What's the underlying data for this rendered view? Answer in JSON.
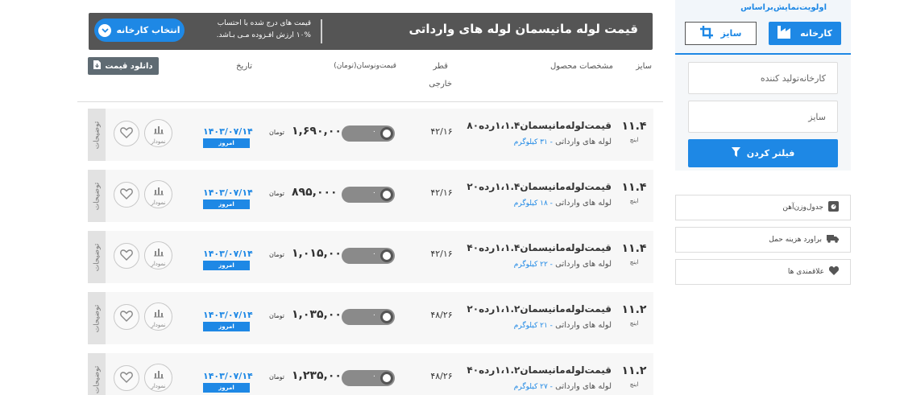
{
  "header": {
    "title": "قیمت لوله مانیسمان لوله های وارداتی",
    "note_line1": "قیمت های درج شده با احتساب",
    "note_line2": "۱۰% ارزش افـزوده مـی بـاشد.",
    "select_factory_label": "انتخاب کارخانه"
  },
  "toolbar": {
    "download_label": "دانلود قیمت"
  },
  "columns": {
    "size": "سایز",
    "specs": "مشخصات محصول",
    "dia_line1": "قطر",
    "dia_line2": "خارجی",
    "price": "قیمت‌ونوسان(تومان)",
    "date": "تاریخ"
  },
  "row_labels": {
    "notes": "توضیحات",
    "chart": "نمودار",
    "today": "امروز",
    "currency": "تومان",
    "size_unit": "اینچ",
    "fluct_value": "۰"
  },
  "rows": [
    {
      "size": "۱۱.۴",
      "title": "قیمت‌لوله‌مانیسمان۱،۱.۴رده۸۰",
      "sub": "لوله های وارداتی",
      "weight": "- ۳۱ کیلوگرم",
      "dia": "۴۲/۱۶",
      "price": "۱,۶۹۰,۰۰۰",
      "date": "۱۴۰۳/۰۷/۱۴"
    },
    {
      "size": "۱۱.۴",
      "title": "قیمت‌لوله‌مانیسمان۱،۱.۴رده۲۰",
      "sub": "لوله های وارداتی",
      "weight": "- ۱۸ کیلوگرم",
      "dia": "۴۲/۱۶",
      "price": "۸۹۵,۰۰۰",
      "date": "۱۴۰۳/۰۷/۱۴"
    },
    {
      "size": "۱۱.۴",
      "title": "قیمت‌لوله‌مانیسمان۱،۱.۴رده۴۰",
      "sub": "لوله های وارداتی",
      "weight": "- ۲۲ کیلوگرم",
      "dia": "۴۲/۱۶",
      "price": "۱,۰۱۵,۰۰۰",
      "date": "۱۴۰۳/۰۷/۱۴"
    },
    {
      "size": "۱۱.۲",
      "title": "قیمت‌لوله‌مانیسمان۱،۱.۲رده۲۰",
      "sub": "لوله های وارداتی",
      "weight": "- ۲۱ کیلوگرم",
      "dia": "۴۸/۲۶",
      "price": "۱,۰۳۵,۰۰۰",
      "date": "۱۴۰۳/۰۷/۱۴"
    },
    {
      "size": "۱۱.۲",
      "title": "قیمت‌لوله‌مانیسمان۱،۱.۲رده۴۰",
      "sub": "لوله های وارداتی",
      "weight": "- ۲۷ کیلوگرم",
      "dia": "۴۸/۲۶",
      "price": "۱,۲۳۵,۰۰۰",
      "date": "۱۴۰۳/۰۷/۱۴"
    }
  ],
  "sidebar": {
    "priority_title": "اولویت‌نمایش‌براساس",
    "tab_factory": "کارخانه",
    "tab_size": "سایز",
    "manufacturer_placeholder": "کارخانه‌تولید کننده",
    "size_placeholder": "سایز",
    "filter_label": "فیلتر کردن",
    "links": [
      {
        "label": "جدول‌وزن‌آهن"
      },
      {
        "label": "براورد هزینه حمل"
      },
      {
        "label": "علاقمندی ها"
      }
    ]
  },
  "colors": {
    "accent": "#1e88e5",
    "title_bar": "#555555",
    "row_bg": "#f7f7f7"
  }
}
